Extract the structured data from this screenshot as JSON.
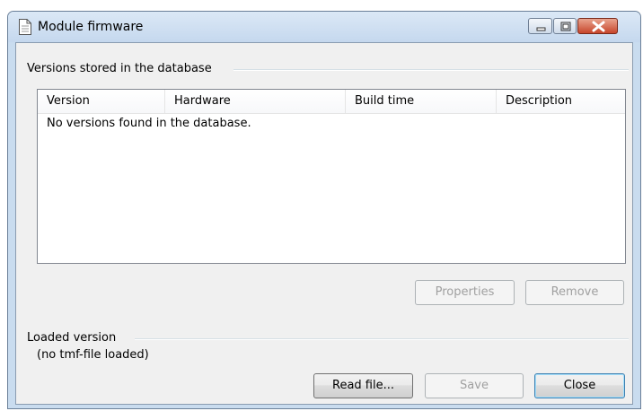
{
  "window": {
    "title": "Module firmware"
  },
  "versions_group": {
    "label": "Versions stored in the database",
    "columns": [
      "Version",
      "Hardware",
      "Build time",
      "Description"
    ],
    "empty_message": "No versions found in the database.",
    "properties_label": "Properties",
    "remove_label": "Remove"
  },
  "loaded_group": {
    "label": "Loaded version",
    "status": "(no tmf-file loaded)"
  },
  "footer": {
    "read_file_label": "Read file...",
    "save_label": "Save",
    "close_label": "Close"
  },
  "colors": {
    "titlebar": "#c9dcef",
    "close_button": "#c7452b",
    "dialog_background": "#f0f0f0"
  }
}
